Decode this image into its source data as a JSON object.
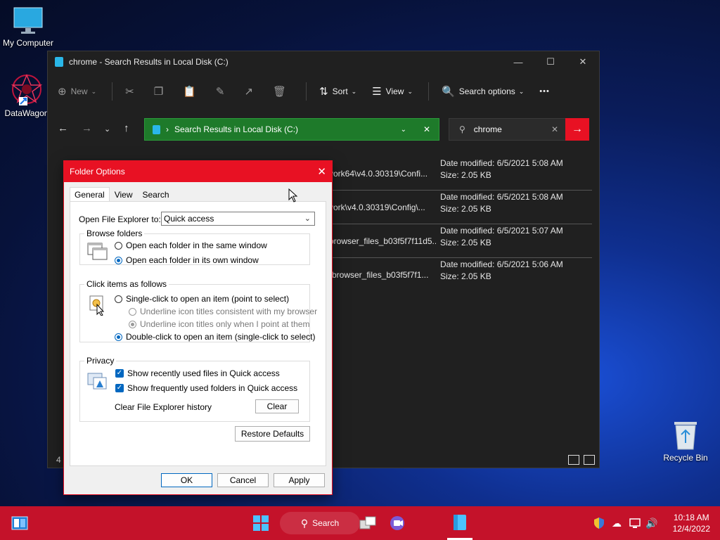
{
  "desktop": {
    "icons": [
      {
        "label": "My Computer"
      },
      {
        "label": "DataWagon"
      },
      {
        "label": "Recycle Bin"
      }
    ]
  },
  "explorer": {
    "title": "chrome - Search Results in Local Disk (C:)",
    "toolbar": {
      "new_label": "New",
      "sort_label": "Sort",
      "view_label": "View",
      "search_options_label": "Search options",
      "more_label": "•••"
    },
    "address": "Search Results in Local Disk (C:)",
    "search_value": "chrome",
    "results": [
      {
        "path": "vork64\\v4.0.30319\\Confi...",
        "date": "Date modified: 6/5/2021 5:08 AM",
        "size": "Size: 2.05 KB"
      },
      {
        "path": "vork\\v4.0.30319\\Config\\...",
        "date": "Date modified: 6/5/2021 5:08 AM",
        "size": "Size: 2.05 KB"
      },
      {
        "path": "browser_files_b03f5f7f11d5...",
        "date": "Date modified: 6/5/2021 5:07 AM",
        "size": "Size: 2.05 KB"
      },
      {
        "path": "-browser_files_b03f5f7f1...",
        "date": "Date modified: 6/5/2021 5:06 AM",
        "size": "Size: 2.05 KB"
      }
    ],
    "status_count": "4"
  },
  "dialog": {
    "title": "Folder Options",
    "tabs": [
      "General",
      "View",
      "Search"
    ],
    "open_to_label": "Open File Explorer to:",
    "open_to_value": "Quick access",
    "browse": {
      "legend": "Browse folders",
      "opt1": "Open each folder in the same window",
      "opt2": "Open each folder in its own window"
    },
    "click": {
      "legend": "Click items as follows",
      "opt1": "Single-click to open an item (point to select)",
      "sub1": "Underline icon titles consistent with my browser",
      "sub2": "Underline icon titles only when I point at them",
      "opt2": "Double-click to open an item (single-click to select)"
    },
    "privacy": {
      "legend": "Privacy",
      "chk1": "Show recently used files in Quick access",
      "chk2": "Show frequently used folders in Quick access",
      "clear_label": "Clear File Explorer history",
      "clear_btn": "Clear"
    },
    "restore_btn": "Restore Defaults",
    "ok_btn": "OK",
    "cancel_btn": "Cancel",
    "apply_btn": "Apply"
  },
  "taskbar": {
    "search_label": "Search",
    "time": "10:18 AM",
    "date": "12/4/2022"
  }
}
